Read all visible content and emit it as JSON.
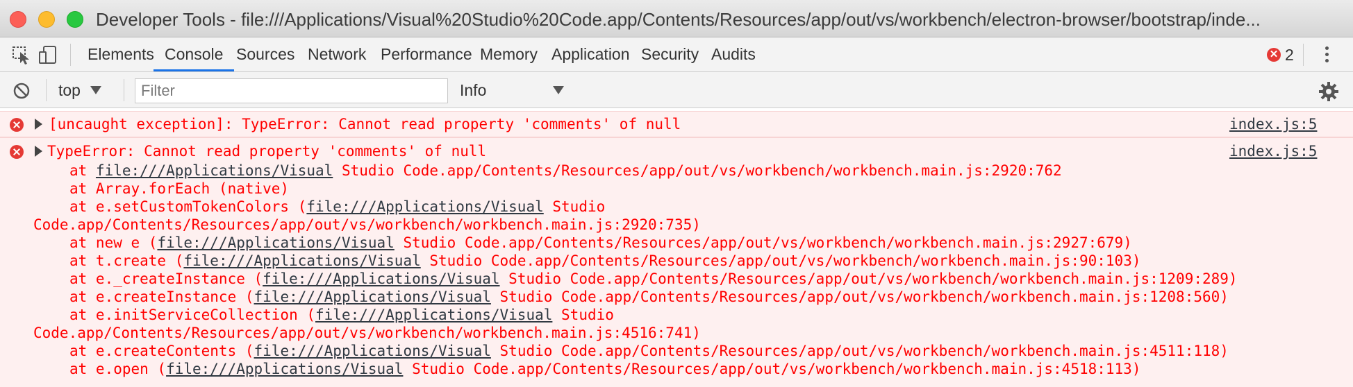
{
  "window": {
    "title": "Developer Tools - file:///Applications/Visual%20Studio%20Code.app/Contents/Resources/app/out/vs/workbench/electron-browser/bootstrap/inde..."
  },
  "tabs": [
    {
      "label": "Elements"
    },
    {
      "label": "Console",
      "active": true
    },
    {
      "label": "Sources"
    },
    {
      "label": "Network"
    },
    {
      "label": "Performance"
    },
    {
      "label": "Memory"
    },
    {
      "label": "Application"
    },
    {
      "label": "Security"
    },
    {
      "label": "Audits"
    }
  ],
  "error_count": "2",
  "console_toolbar": {
    "context": "top",
    "filter_placeholder": "Filter",
    "level": "Info"
  },
  "messages": [
    {
      "text": "[uncaught exception]: TypeError: Cannot read property 'comments' of null",
      "source": "index.js:5"
    },
    {
      "text": "TypeError: Cannot read property 'comments' of null",
      "source": "index.js:5",
      "stack": [
        {
          "prefix": "at ",
          "link": "file:///Applications/Visual",
          "rest": " Studio Code.app/Contents/Resources/app/out/vs/workbench/workbench.main.js:2920:762"
        },
        {
          "prefix": "at Array.forEach (native)",
          "link": "",
          "rest": ""
        },
        {
          "prefix": "at e.setCustomTokenColors (",
          "link": "file:///Applications/Visual",
          "rest": " Studio"
        },
        {
          "prefix": "Code.app/Contents/Resources/app/out/vs/workbench/workbench.main.js:2920:735)",
          "link": "",
          "rest": "",
          "wrap": true
        },
        {
          "prefix": "at new e (",
          "link": "file:///Applications/Visual",
          "rest": " Studio Code.app/Contents/Resources/app/out/vs/workbench/workbench.main.js:2927:679)"
        },
        {
          "prefix": "at t.create (",
          "link": "file:///Applications/Visual",
          "rest": " Studio Code.app/Contents/Resources/app/out/vs/workbench/workbench.main.js:90:103)"
        },
        {
          "prefix": "at e._createInstance (",
          "link": "file:///Applications/Visual",
          "rest": " Studio Code.app/Contents/Resources/app/out/vs/workbench/workbench.main.js:1209:289)"
        },
        {
          "prefix": "at e.createInstance (",
          "link": "file:///Applications/Visual",
          "rest": " Studio Code.app/Contents/Resources/app/out/vs/workbench/workbench.main.js:1208:560)"
        },
        {
          "prefix": "at e.initServiceCollection (",
          "link": "file:///Applications/Visual",
          "rest": " Studio"
        },
        {
          "prefix": "Code.app/Contents/Resources/app/out/vs/workbench/workbench.main.js:4516:741)",
          "link": "",
          "rest": "",
          "wrap": true
        },
        {
          "prefix": "at e.createContents (",
          "link": "file:///Applications/Visual",
          "rest": " Studio Code.app/Contents/Resources/app/out/vs/workbench/workbench.main.js:4511:118)"
        },
        {
          "prefix": "at e.open (",
          "link": "file:///Applications/Visual",
          "rest": " Studio Code.app/Contents/Resources/app/out/vs/workbench/workbench.main.js:4518:113)"
        }
      ]
    }
  ]
}
